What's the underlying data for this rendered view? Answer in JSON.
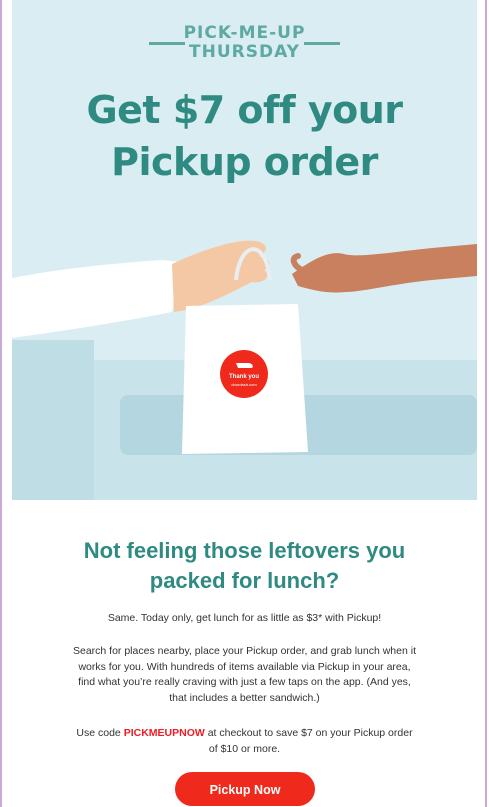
{
  "hero": {
    "kicker_line1": "PICK-ME-UP",
    "kicker_line2": "THURSDAY",
    "headline_line1": "Get $7 off your",
    "headline_line2": "Pickup order",
    "bag_label": "Thank you",
    "bag_sublabel": "doordash.com"
  },
  "body": {
    "subhead_line1": "Not feeling those leftovers you",
    "subhead_line2": "packed for lunch?",
    "paragraph1": "Same. Today only, get lunch for as little as $3* with Pickup!",
    "paragraph2_line1": "Search for places nearby, place your Pickup order, and grab lunch when it",
    "paragraph2_line2": "works for you. With hundreds of items available via Pickup in your area,",
    "paragraph2_line3": "find what you’re really craving with just a few taps on the app. (And yes,",
    "paragraph2_line4": "that includes a better sandwich.)",
    "paragraph3_prefix": "Use code ",
    "promo_code": "PICKMEUPNOW",
    "paragraph3_suffix": " at checkout to save $7 on your Pickup order",
    "paragraph3_line2": "of $10 or more.",
    "cta_label": "Pickup Now"
  },
  "colors": {
    "hero_bg": "#d9edf2",
    "teal": "#2f8a82",
    "kicker": "#5fa9a3",
    "brand_red": "#ef2a1c",
    "code_red": "#ef1c24"
  }
}
